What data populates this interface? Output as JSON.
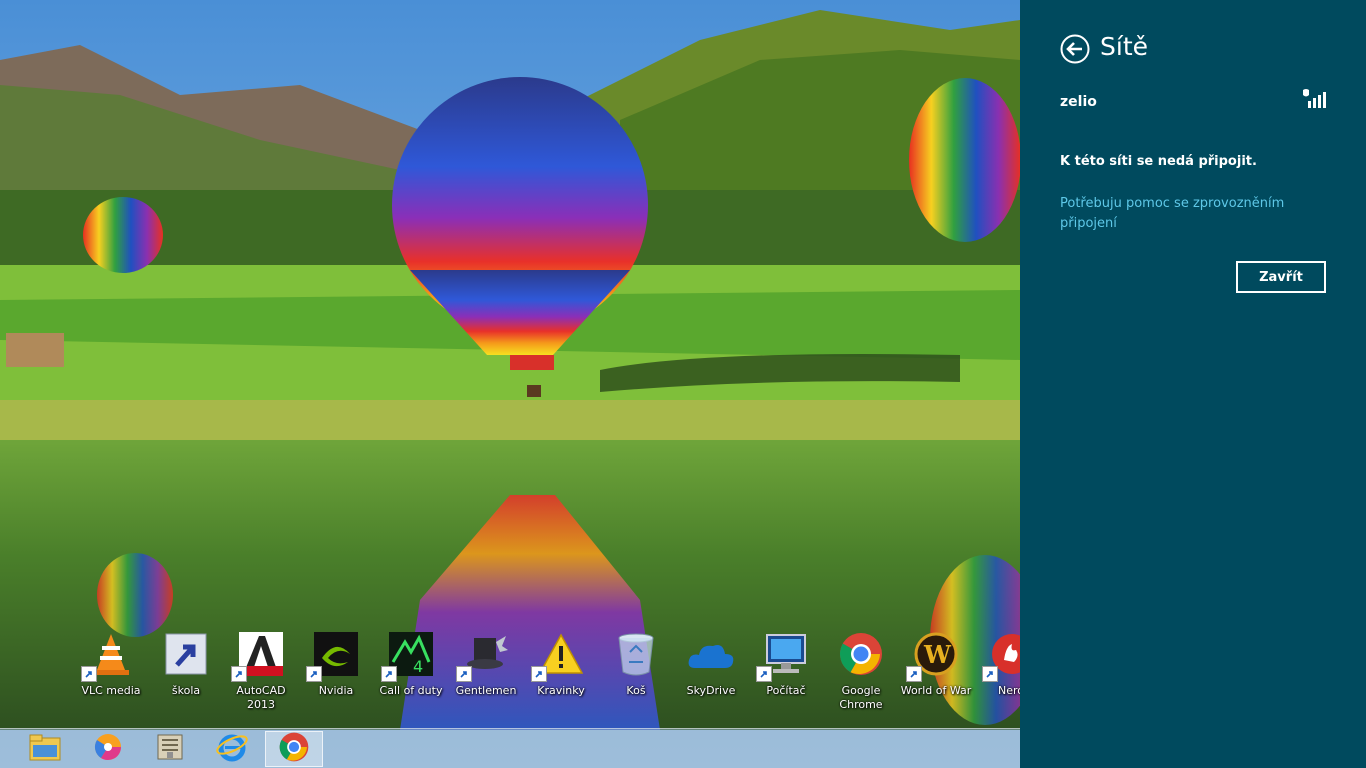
{
  "desktop": {
    "icons": [
      {
        "label": "VLC media",
        "icon": "vlc-icon"
      },
      {
        "label": "škola",
        "icon": "folder-shortcut-icon"
      },
      {
        "label": "AutoCAD 2013",
        "icon": "autocad-icon"
      },
      {
        "label": "Nvidia",
        "icon": "nvidia-icon"
      },
      {
        "label": "Call of duty",
        "icon": "call-of-duty-icon"
      },
      {
        "label": "Gentlemen",
        "icon": "gentlemen-icon"
      },
      {
        "label": "Kravinky",
        "icon": "warning-icon"
      },
      {
        "label": "Koš",
        "icon": "recycle-bin-icon"
      },
      {
        "label": "SkyDrive",
        "icon": "skydrive-icon"
      },
      {
        "label": "Počítač",
        "icon": "computer-icon"
      },
      {
        "label": "Google Chrome",
        "icon": "chrome-icon"
      },
      {
        "label": "World of War",
        "icon": "world-of-warcraft-icon"
      },
      {
        "label": "Nero",
        "icon": "nero-icon"
      }
    ]
  },
  "taskbar": {
    "buttons": [
      {
        "icon": "file-explorer-icon"
      },
      {
        "icon": "media-player-icon"
      },
      {
        "icon": "archive-icon"
      },
      {
        "icon": "internet-explorer-icon"
      },
      {
        "icon": "chrome-icon",
        "active": true
      }
    ]
  },
  "networks_panel": {
    "title": "Sítě",
    "network_name": "zelio",
    "error_message": "K této síti se nedá připojit.",
    "help_link": "Potřebuju pomoc se zprovozněním připojení",
    "close_button": "Zavřít",
    "background_color": "#004a5e",
    "link_color": "#5ec8e8"
  }
}
